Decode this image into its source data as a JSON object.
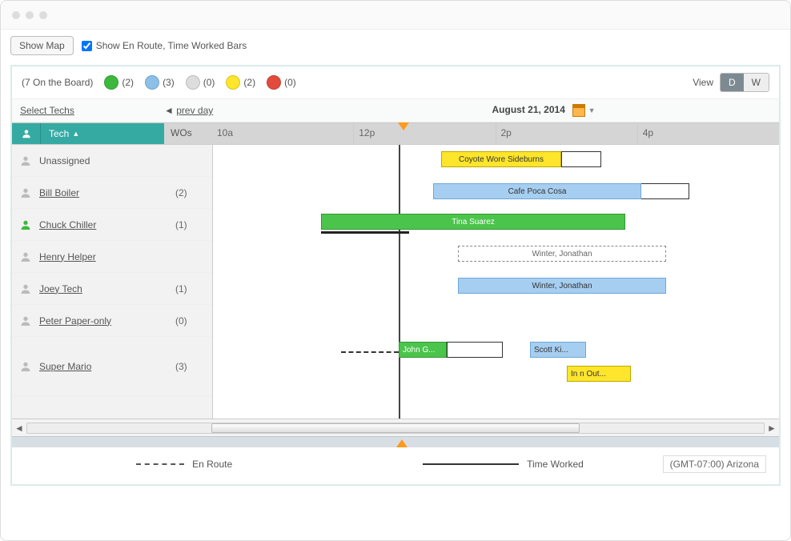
{
  "toolbar": {
    "show_map_label": "Show Map",
    "checkbox_label": "Show En Route, Time Worked Bars",
    "checkbox_checked": true
  },
  "summary": {
    "on_board": "(7 On the Board)",
    "stats": [
      {
        "color": "green",
        "count": "(2)"
      },
      {
        "color": "blue",
        "count": "(3)"
      },
      {
        "color": "gray",
        "count": "(0)"
      },
      {
        "color": "yellow",
        "count": "(2)"
      },
      {
        "color": "red",
        "count": "(0)"
      }
    ],
    "view_label": "View",
    "view_d": "D",
    "view_w": "W"
  },
  "nav": {
    "select_techs": "Select Techs",
    "prev_day": "prev day",
    "date": "August 21, 2014"
  },
  "columns": {
    "tech": "Tech",
    "wos": "WOs",
    "times": [
      "10a",
      "12p",
      "2p",
      "4p"
    ]
  },
  "techs": [
    {
      "name": "Unassigned",
      "wo": "",
      "link": false,
      "status": "gray"
    },
    {
      "name": "Bill Boiler",
      "wo": "(2)",
      "link": true,
      "status": "gray"
    },
    {
      "name": "Chuck Chiller",
      "wo": "(1)",
      "link": true,
      "status": "green"
    },
    {
      "name": "Henry Helper",
      "wo": "",
      "link": true,
      "status": "gray"
    },
    {
      "name": "Joey Tech",
      "wo": "(1)",
      "link": true,
      "status": "gray"
    },
    {
      "name": "Peter Paper-only",
      "wo": "(0)",
      "link": true,
      "status": "gray"
    },
    {
      "name": "Super Mario",
      "wo": "(3)",
      "link": true,
      "status": "gray"
    }
  ],
  "jobs": {
    "coyote": "Coyote Wore Sideburns",
    "cafe": "Cafe Poca Cosa",
    "tina": "Tina Suarez",
    "winter": "Winter, Jonathan",
    "john": "John G...",
    "scott": "Scott Ki...",
    "innout": "In n Out..."
  },
  "legend": {
    "enroute": "En Route",
    "worked": "Time Worked",
    "tz": "(GMT-07:00) Arizona"
  }
}
